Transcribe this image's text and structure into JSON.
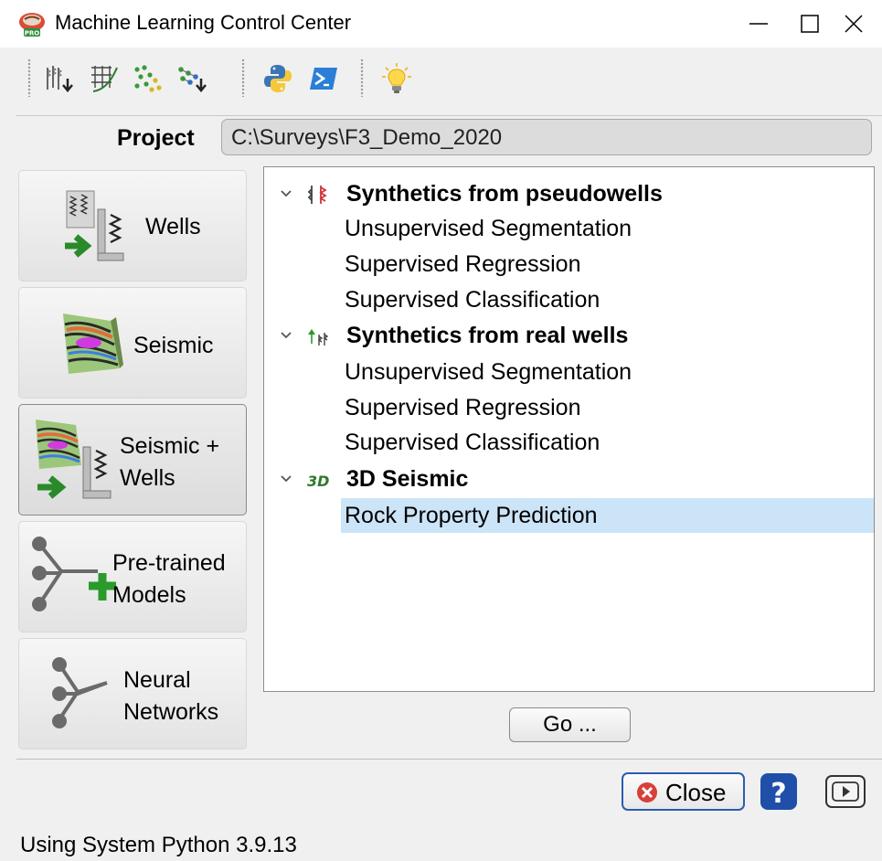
{
  "window": {
    "title": "Machine Learning Control Center",
    "icon": "app-logo-icon"
  },
  "toolbar": {
    "items": [
      {
        "name": "well-logs-import-icon"
      },
      {
        "name": "log-crossplot-icon"
      },
      {
        "name": "scatter-points-icon"
      },
      {
        "name": "network-import-icon"
      },
      {
        "name": "python-icon"
      },
      {
        "name": "powershell-icon"
      },
      {
        "name": "lightbulb-icon"
      }
    ]
  },
  "project": {
    "label": "Project",
    "value": "C:\\Surveys\\F3_Demo_2020"
  },
  "sidebar": {
    "wells": "Wells",
    "seismic": "Seismic",
    "seismic_wells_1": "Seismic +",
    "seismic_wells_2": "Wells",
    "pretrained_1": "Pre-trained",
    "pretrained_2": "Models",
    "neural_1": "Neural",
    "neural_2": "Networks"
  },
  "tree": {
    "cat1": {
      "label": "Synthetics from pseudowells",
      "items": [
        "Unsupervised Segmentation",
        "Supervised Regression",
        "Supervised Classification"
      ]
    },
    "cat2": {
      "label": "Synthetics from real wells",
      "items": [
        "Unsupervised Segmentation",
        "Supervised Regression",
        "Supervised Classification"
      ]
    },
    "cat3": {
      "label": "3D Seismic",
      "items": [
        "Rock Property Prediction"
      ]
    },
    "selected_color": "#cce4f7"
  },
  "buttons": {
    "go": "Go ...",
    "close": "Close"
  },
  "status": "Using System Python 3.9.13"
}
